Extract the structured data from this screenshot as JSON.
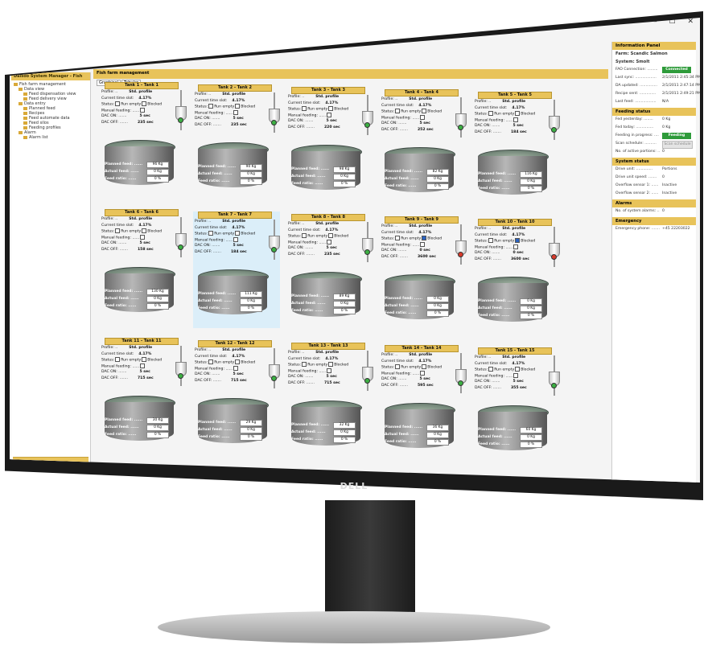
{
  "window": {
    "title": "Dalsoo System Manager Fish - Scandic Salmon v3.0.0",
    "controls": [
      "–",
      "☐",
      "✕"
    ],
    "menu": "File  Settings  Controller  Database  Report"
  },
  "left_pane": {
    "header": "Dalsoo System Manager - Fish",
    "tree": [
      {
        "level": 0,
        "label": "Fish farm management"
      },
      {
        "level": 1,
        "label": "Data view"
      },
      {
        "level": 2,
        "label": "Feed dispensation view"
      },
      {
        "level": 2,
        "label": "Feed delivery view"
      },
      {
        "level": 1,
        "label": "Data entry"
      },
      {
        "level": 2,
        "label": "Planned feed"
      },
      {
        "level": 2,
        "label": "Recipes"
      },
      {
        "level": 2,
        "label": "Feed automate data"
      },
      {
        "level": 2,
        "label": "Feed silos"
      },
      {
        "level": 2,
        "label": "Feeding profiles"
      },
      {
        "level": 1,
        "label": "Alarm"
      },
      {
        "level": 2,
        "label": "Alarm list"
      }
    ],
    "nav_buttons": [
      "Fish farm management",
      "Feeding system setup"
    ]
  },
  "center": {
    "header": "Fish farm management",
    "tabs": [
      "Graphical",
      "Tabular"
    ]
  },
  "labels": {
    "profile": "Profile: ..",
    "current": "Current time slot:",
    "status": "Status:",
    "run_empty": "Run empty",
    "blocked": "Blocked",
    "manual": "Manual feeding: ......",
    "dac_on": "DAC ON: .......",
    "dac_off": "DAC OFF: .......",
    "planned": "Planned feed: ......",
    "actual": "Actual feed: ......",
    "ratio": "Feed ratio: ......"
  },
  "tanks": [
    {
      "name": "Tank 1 - Tank 1",
      "profile": "Std. profile",
      "slot": "4.17%",
      "run_empty": false,
      "blocked": false,
      "dac_on": "5 sec",
      "dac_off": "235 sec",
      "planned": "96 Kg",
      "actual": "0 Kg",
      "ratio": "0 %",
      "led": "green"
    },
    {
      "name": "Tank 2 - Tank 2",
      "profile": "Std. profile",
      "slot": "4.17%",
      "run_empty": false,
      "blocked": false,
      "dac_on": "5 sec",
      "dac_off": "235 sec",
      "planned": "90 Kg",
      "actual": "0 Kg",
      "ratio": "0 %",
      "led": "green"
    },
    {
      "name": "Tank 3 - Tank 3",
      "profile": "Std. profile",
      "slot": "4.17%",
      "run_empty": false,
      "blocked": false,
      "dac_on": "5 sec",
      "dac_off": "220 sec",
      "planned": "98 Kg",
      "actual": "0 Kg",
      "ratio": "0 %",
      "led": "green"
    },
    {
      "name": "Tank 4 - Tank 4",
      "profile": "Std. profile",
      "slot": "4.17%",
      "run_empty": false,
      "blocked": false,
      "dac_on": "5 sec",
      "dac_off": "252 sec",
      "planned": "82 Kg",
      "actual": "0 Kg",
      "ratio": "0 %",
      "led": "green"
    },
    {
      "name": "Tank 5 - Tank 5",
      "profile": "Std. profile",
      "slot": "4.17%",
      "run_empty": false,
      "blocked": false,
      "dac_on": "5 sec",
      "dac_off": "184 sec",
      "planned": "116 Kg",
      "actual": "0 Kg",
      "ratio": "0 %",
      "led": "green"
    },
    {
      "name": "Tank 6 - Tank 6",
      "profile": "Std. profile",
      "slot": "4.17%",
      "run_empty": false,
      "blocked": false,
      "dac_on": "5 sec",
      "dac_off": "158 sec",
      "planned": "130 Kg",
      "actual": "0 Kg",
      "ratio": "0 %",
      "led": "green"
    },
    {
      "name": "Tank 7 - Tank 7",
      "profile": "Std. profile",
      "slot": "4.17%",
      "run_empty": false,
      "blocked": false,
      "dac_on": "5 sec",
      "dac_off": "184 sec",
      "planned": "111 Kg",
      "actual": "0 Kg",
      "ratio": "0 %",
      "led": "green"
    },
    {
      "name": "Tank 8 - Tank 8",
      "profile": "Std. profile",
      "slot": "4.17%",
      "run_empty": false,
      "blocked": false,
      "dac_on": "5 sec",
      "dac_off": "235 sec",
      "planned": "89 Kg",
      "actual": "0 Kg",
      "ratio": "0 %",
      "led": "green"
    },
    {
      "name": "Tank 9 - Tank 9",
      "profile": "Std. profile",
      "slot": "4.17%",
      "run_empty": false,
      "blocked": true,
      "dac_on": "0 sec",
      "dac_off": "3600 sec",
      "planned": "0 Kg",
      "actual": "0 Kg",
      "ratio": "0 %",
      "led": "red"
    },
    {
      "name": "Tank 10 - Tank 10",
      "profile": "Std. profile",
      "slot": "4.17%",
      "run_empty": false,
      "blocked": true,
      "dac_on": "0 sec",
      "dac_off": "3600 sec",
      "planned": "0 Kg",
      "actual": "0 Kg",
      "ratio": "0 %",
      "led": "red"
    },
    {
      "name": "Tank 11 - Tank 11",
      "profile": "Std. profile",
      "slot": "4.17%",
      "run_empty": false,
      "blocked": false,
      "dac_on": "5 sec",
      "dac_off": "715 sec",
      "planned": "30 Kg",
      "actual": "0 Kg",
      "ratio": "0 %",
      "led": "green"
    },
    {
      "name": "Tank 12 - Tank 12",
      "profile": "Std. profile",
      "slot": "4.17%",
      "run_empty": false,
      "blocked": false,
      "dac_on": "5 sec",
      "dac_off": "715 sec",
      "planned": "29 Kg",
      "actual": "0 Kg",
      "ratio": "0 %",
      "led": "green"
    },
    {
      "name": "Tank 13 - Tank 13",
      "profile": "Std. profile",
      "slot": "4.17%",
      "run_empty": false,
      "blocked": false,
      "dac_on": "5 sec",
      "dac_off": "715 sec",
      "planned": "32 Kg",
      "actual": "0 Kg",
      "ratio": "0 %",
      "led": "green"
    },
    {
      "name": "Tank 14 - Tank 14",
      "profile": "Std. profile",
      "slot": "4.17%",
      "run_empty": false,
      "blocked": false,
      "dac_on": "5 sec",
      "dac_off": "595 sec",
      "planned": "36 Kg",
      "actual": "0 Kg",
      "ratio": "0 %",
      "led": "green"
    },
    {
      "name": "Tank 15 - Tank 15",
      "profile": "Std. profile",
      "slot": "4.17%",
      "run_empty": false,
      "blocked": false,
      "dac_on": "5 sec",
      "dac_off": "355 sec",
      "planned": "60 Kg",
      "actual": "0 Kg",
      "ratio": "0 %",
      "led": "green"
    }
  ],
  "info_panel": {
    "title": "Information Panel",
    "farm": "Farm: Scandic Salmon",
    "system": "System: Smolt",
    "rows1": [
      {
        "label": "FAO Connection: .........",
        "value": "Connected",
        "style": "green"
      },
      {
        "label": "Last sync: ..................",
        "value": "2/1/2011 2:45:34 PM"
      },
      {
        "label": "DA updated: ...............",
        "value": "2/1/2011 2:47:14 PM"
      },
      {
        "label": "Recipe sent: ..............",
        "value": "2/1/2011 2:49:21 PM"
      },
      {
        "label": "Last feed: ..................",
        "value": "N/A"
      }
    ],
    "feeding_status_title": "Feeding status",
    "rows2": [
      {
        "label": "Fed yesterday: ........",
        "value": "0 Kg"
      },
      {
        "label": "Fed today: ...............",
        "value": "0 Kg"
      },
      {
        "label": "Feeding in progress: ....",
        "value": "Feeding",
        "style": "green"
      },
      {
        "label": "Scan schedule: ..........",
        "value": "Scan schedule",
        "style": "grey"
      },
      {
        "label": "No. of active portions: ..",
        "value": "0"
      }
    ],
    "system_status_title": "System status",
    "rows3": [
      {
        "label": "Drive unit: ..............",
        "value": "Portions"
      },
      {
        "label": "Drive unit speed: .......",
        "value": "0"
      },
      {
        "label": "Overflow sensor 1: ......",
        "value": "Inactive"
      },
      {
        "label": "Overflow sensor 2: ......",
        "value": "Inactive"
      }
    ],
    "alarms_title": "Alarms",
    "rows4": [
      {
        "label": "No. of system alarms: ..",
        "value": "0"
      }
    ],
    "emergency_title": "Emergency",
    "rows5": [
      {
        "label": "Emergency phone: .......",
        "value": "+45 22203022"
      }
    ]
  },
  "logo": "DELL"
}
